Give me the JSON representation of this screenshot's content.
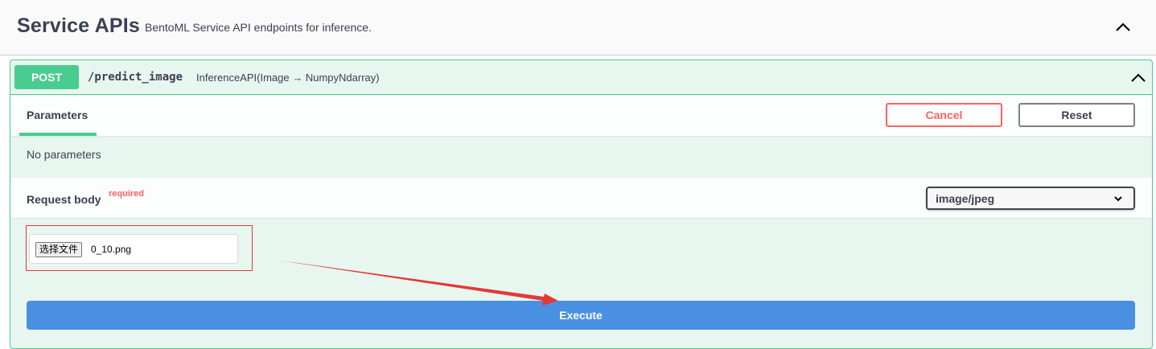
{
  "tag": {
    "title": "Service APIs",
    "description": "BentoML Service API endpoints for inference."
  },
  "operation": {
    "method": "POST",
    "path": "/predict_image",
    "summary": "InferenceAPI(Image → NumpyNdarray)",
    "parameters_tab": "Parameters",
    "cancel_label": "Cancel",
    "reset_label": "Reset",
    "no_parameters": "No parameters",
    "request_body_label": "Request body",
    "required_label": "required",
    "content_type": "image/jpeg",
    "file_button_label": "选择文件",
    "file_name": "0_10.png",
    "execute_label": "Execute"
  },
  "colors": {
    "post_accent": "#49cc90",
    "cancel_red": "#ff6060",
    "execute_blue": "#4990e2",
    "annotation_red": "#e53935"
  },
  "icons": {
    "tag_toggle": "chevron-up-icon",
    "summary_toggle": "chevron-up-icon",
    "content_type_dropdown": "chevron-down-icon"
  }
}
